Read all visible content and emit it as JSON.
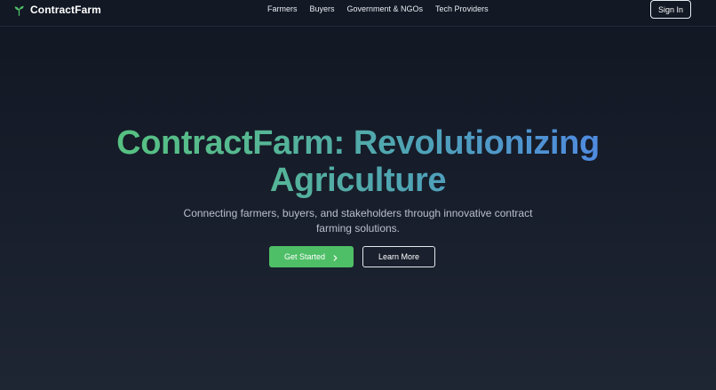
{
  "header": {
    "brand_name": "ContractFarm",
    "brand_icon": "sprout-icon",
    "nav": [
      {
        "label": "Farmers"
      },
      {
        "label": "Buyers"
      },
      {
        "label": "Government & NGOs"
      },
      {
        "label": "Tech Providers"
      }
    ],
    "signin_label": "Sign In"
  },
  "hero": {
    "title": "ContractFarm: Revolutionizing Agriculture",
    "subtitle": "Connecting farmers, buyers, and stakeholders through innovative contract farming solutions.",
    "primary_cta": "Get Started",
    "primary_cta_icon": "chevron-right-icon",
    "secondary_cta": "Learn More"
  },
  "colors": {
    "accent_green": "#4fbf67",
    "gradient_start": "#56c47c",
    "gradient_end": "#4f86e8",
    "background": "#161c29"
  }
}
